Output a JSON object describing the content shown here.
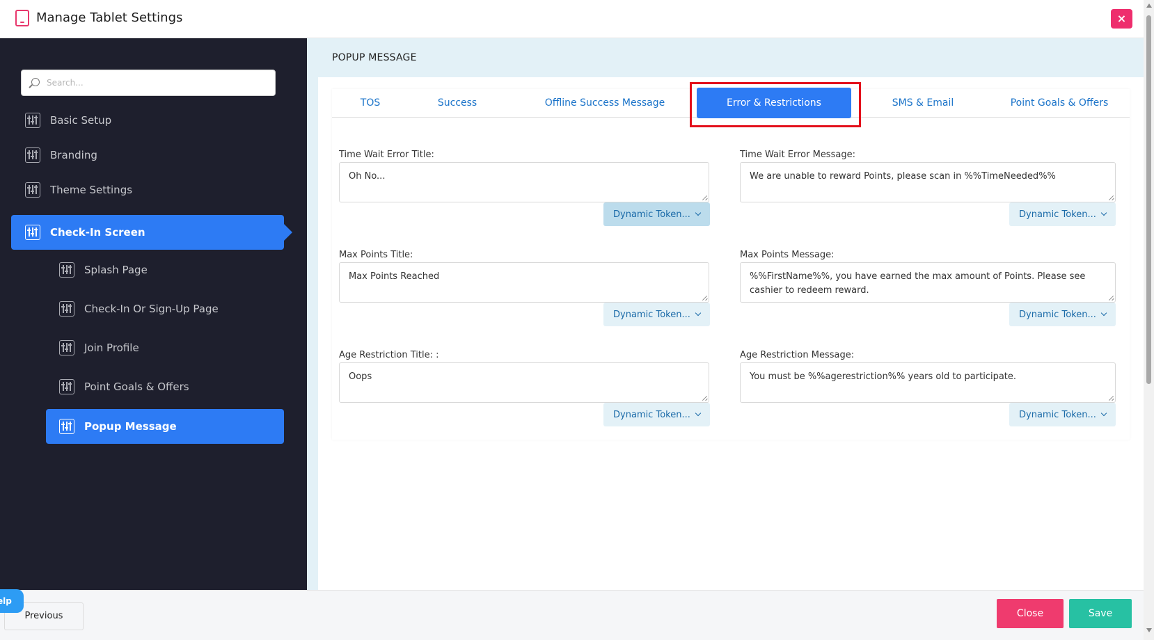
{
  "header": {
    "title": "Manage Tablet Settings",
    "icon": "tablet-icon",
    "close_icon": "close-icon",
    "close_symbol": "×",
    "accent": "#ee2e6d"
  },
  "sidebar": {
    "search_placeholder": "Search...",
    "items": [
      {
        "label": "Basic Setup"
      },
      {
        "label": "Branding"
      },
      {
        "label": "Theme Settings"
      },
      {
        "label": "Check-In Screen"
      },
      {
        "label": "Splash Page"
      },
      {
        "label": "Check-In Or Sign-Up Page"
      },
      {
        "label": "Join Profile"
      },
      {
        "label": "Point Goals & Offers"
      },
      {
        "label": "Popup Message"
      }
    ],
    "active_color": "#2d7bf4"
  },
  "main": {
    "heading": "POPUP MESSAGE",
    "tabs": [
      {
        "label": "TOS"
      },
      {
        "label": "Success"
      },
      {
        "label": "Offline Success Message"
      },
      {
        "label": "Error & Restrictions"
      },
      {
        "label": "SMS & Email"
      },
      {
        "label": "Point Goals & Offers"
      }
    ],
    "active_tab": "Error & Restrictions",
    "fields": [
      {
        "label": "Time Wait Error Title:",
        "value": "Oh No..."
      },
      {
        "label": "Time Wait Error Message:",
        "value": "We are unable to reward Points, please scan in  %%TimeNeeded%%"
      },
      {
        "label": "Max Points Title:",
        "value": "Max Points Reached"
      },
      {
        "label": "Max Points Message:",
        "value": "%%FirstName%%, you have earned the max amount of Points. Please see cashier to redeem reward."
      },
      {
        "label": "Age Restriction Title: :",
        "value": "Oops"
      },
      {
        "label": "Age Restriction Message:",
        "value": "You must be %%agerestriction%% years old to participate."
      }
    ],
    "token_button_label": "Dynamic Token..."
  },
  "footer": {
    "previous": "Previous",
    "close": "Close",
    "save": "Save",
    "help": "elp"
  }
}
